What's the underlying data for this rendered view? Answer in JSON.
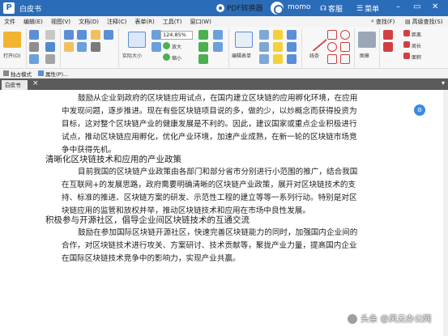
{
  "app": {
    "title": "白皮书",
    "logo_letter": "P"
  },
  "titlebar": {
    "pdf_converter": "PDF转换器",
    "momo": "momo",
    "service": "客服",
    "menu": "菜单"
  },
  "menubar": {
    "items": [
      "文件",
      "编辑(E)",
      "视图(V)",
      "文档(D)",
      "注释(C)",
      "表单(R)",
      "工具(T)",
      "窗口(W)"
    ],
    "search": "查找(F)",
    "advanced_search": "高级查找(S)"
  },
  "ribbon": {
    "open": "打开(O)",
    "actual_size": "实际大小",
    "zoom_value": "124.85%",
    "zoom_in": "放大",
    "zoom_out": "缩小",
    "edit_form": "编辑表单",
    "line": "线条",
    "image": "图章",
    "distance": "距离",
    "perimeter": "周长",
    "area": "面积"
  },
  "modebar": {
    "exclusive_mode": "独占模式",
    "properties": "属性(P)..."
  },
  "tab": {
    "name": "白皮书"
  },
  "document": {
    "lines": [
      "鼓励从企业到政府的区块链应用试点，在国内建立区块链的应用孵化环境，在应用",
      "中发现问题，逐步推进。现在有些区块链项目说的多，做的少，以炒概念而获得投资为",
      "目标，这对整个区块链产业的健康发展是不利的。因此，建议国家或重点企业积极进行",
      "试点，推动区块链应用孵化，优化产业环境，加速产业成熟，在新一轮的区块链市场竞",
      "争中获得先机。"
    ],
    "heading1": "清晰化区块链技术和应用的产业政策",
    "lines2": [
      "目前我国的区块链产业政策由各部门和部分省市分别进行小范围的推广，结合我国",
      "在互联网+的发展思路，政府需要明确清晰的区块链产业政策，展开对区块链技术的支",
      "持、标准的推进、区块链方案的研发、示范性工程的建立等等一系列行动。特别是对区",
      "块链应用的监管和放权并举，推动区块链技术和应用在市场中良性发展。"
    ],
    "heading2": "积极参与开源社区，倡导企业间区块链技术的互通交流",
    "lines3": [
      "鼓励在参加国际区块链开源社区，快速完善区块链能力的同时，加强国内企业间的",
      "合作，对区块链技术进行攻关、方案研讨、技术贡献等，聚拢产业力量，提高国内企业",
      "在国际区块链技术竞争中的影响力，实现产业共赢。"
    ]
  },
  "watermark": {
    "text": "头条 @风云办公网"
  },
  "colors": {
    "titlebar": "#2b6cb8",
    "tabstrip": "#5a5a5a",
    "float_button": "#3a8be0"
  }
}
